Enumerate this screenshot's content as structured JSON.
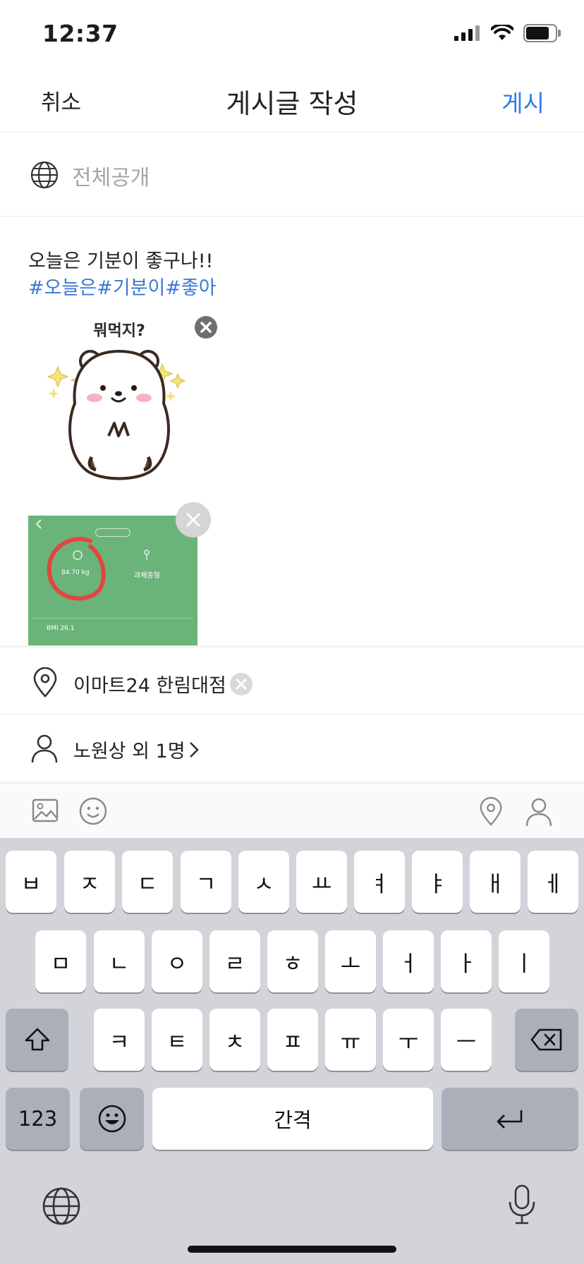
{
  "status_bar": {
    "time": "12:37"
  },
  "nav": {
    "cancel": "취소",
    "title": "게시글 작성",
    "post": "게시"
  },
  "privacy": {
    "label": "전체공개",
    "icon": "globe-icon"
  },
  "post": {
    "text": "오늘은 기분이 좋구나!!",
    "hashtags": "#오늘은#기분이#좋아"
  },
  "attachments": {
    "sticker_caption": "뭐먹지?",
    "photo": {
      "weight": "84.70 kg",
      "body_type": "과체중형",
      "bmi": "BMI 26.1"
    }
  },
  "location": {
    "label": "이마트24 한림대점",
    "icon": "location-pin-icon"
  },
  "people": {
    "label": "노원상 외 1명",
    "icon": "person-icon"
  },
  "toolbar": {
    "left_icons": [
      "image-icon",
      "emoji-icon"
    ],
    "right_icons": [
      "location-pin-icon",
      "person-icon"
    ]
  },
  "keyboard": {
    "row1": [
      "ㅂ",
      "ㅈ",
      "ㄷ",
      "ㄱ",
      "ㅅ",
      "ㅛ",
      "ㅕ",
      "ㅑ",
      "ㅐ",
      "ㅔ"
    ],
    "row2": [
      "ㅁ",
      "ㄴ",
      "ㅇ",
      "ㄹ",
      "ㅎ",
      "ㅗ",
      "ㅓ",
      "ㅏ",
      "ㅣ"
    ],
    "row3": [
      "ㅋ",
      "ㅌ",
      "ㅊ",
      "ㅍ",
      "ㅠ",
      "ㅜ",
      "ㅡ"
    ],
    "numbers": "123",
    "space": "간격"
  },
  "colors": {
    "accent": "#2f7be8",
    "hashtag": "#3a78d6",
    "keyboard_bg": "#d2d4da",
    "photo_green": "#6ab47a"
  }
}
